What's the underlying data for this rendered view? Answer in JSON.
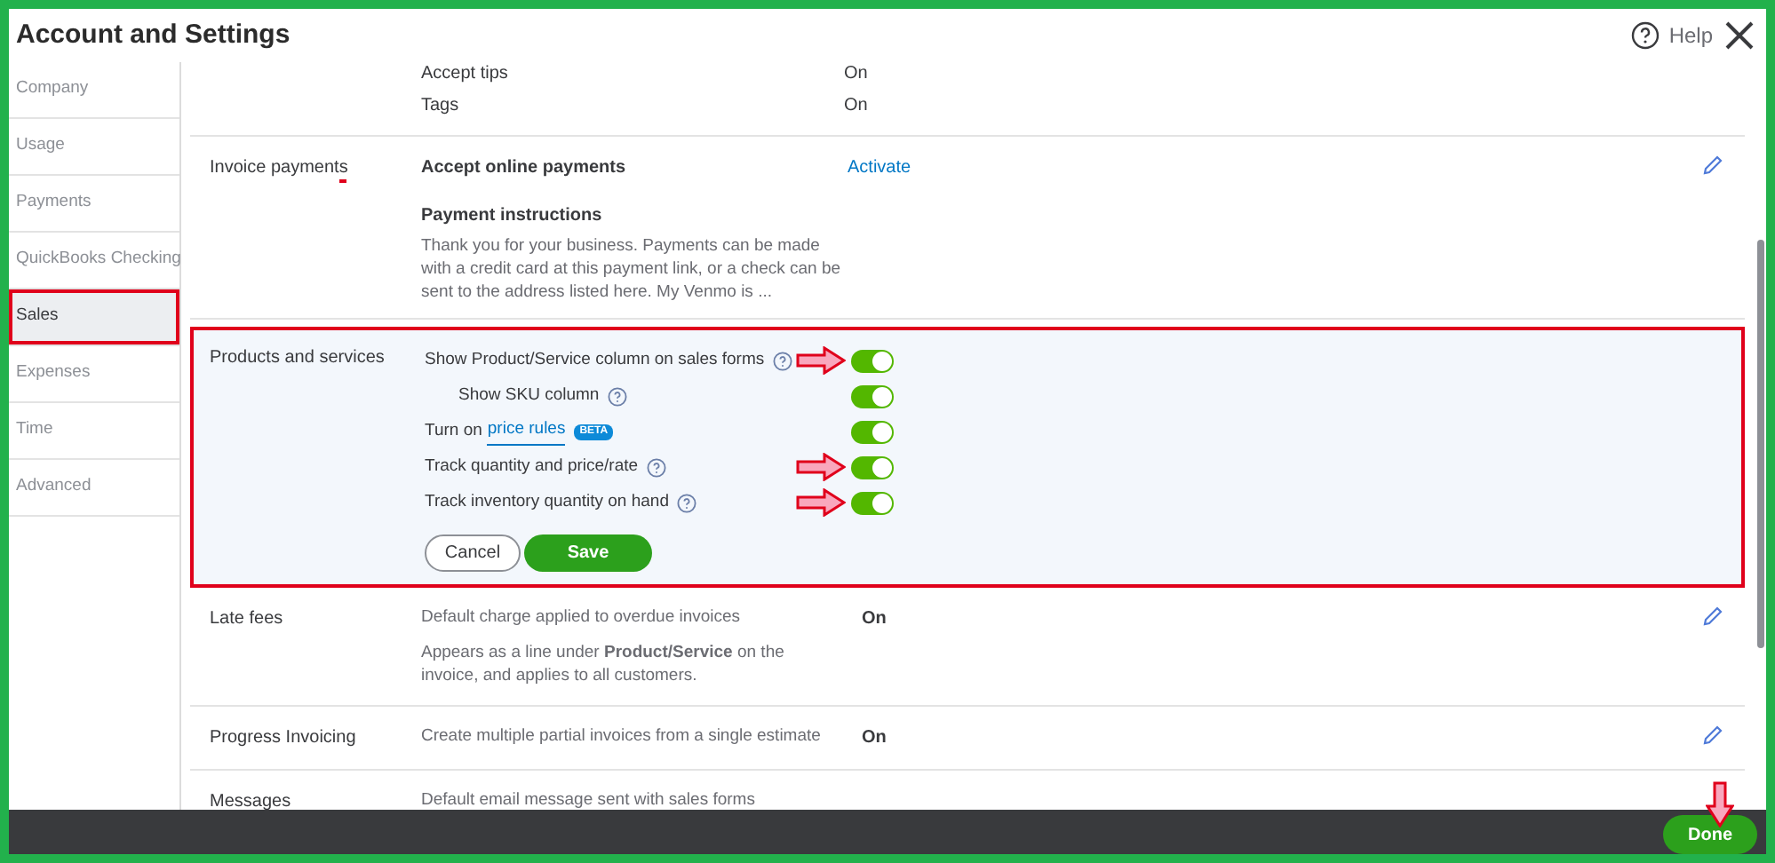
{
  "window": {
    "title": "Account and Settings",
    "help": "Help"
  },
  "sidebar": {
    "items": [
      {
        "label": "Company",
        "selected": false
      },
      {
        "label": "Usage",
        "selected": false
      },
      {
        "label": "Payments",
        "selected": false
      },
      {
        "label": "QuickBooks Checking",
        "selected": false
      },
      {
        "label": "Sales",
        "selected": true
      },
      {
        "label": "Expenses",
        "selected": false
      },
      {
        "label": "Time",
        "selected": false
      },
      {
        "label": "Advanced",
        "selected": false
      }
    ]
  },
  "sections": [
    {
      "kind": "plain",
      "lines": [
        {
          "label": "Accept tips",
          "value": "On"
        },
        {
          "label": "Tags",
          "value": "On"
        }
      ]
    },
    {
      "kind": "payments",
      "title": "Invoice payments",
      "editable": true,
      "setting": "Accept online payments",
      "action": "Activate",
      "subheading": "Payment instructions",
      "description": "Thank you for your business. Payments can be made with a credit card at this payment link, or a check can be sent to the address listed here. My Venmo is ..."
    },
    {
      "kind": "toggles",
      "title": "Products and services",
      "rows": [
        {
          "label": "Show Product/Service column on sales forms",
          "help": true,
          "on": true,
          "arrow": true,
          "children": [
            {
              "label": "Show SKU column",
              "help": true,
              "on": true,
              "arrow": false
            }
          ]
        },
        {
          "label": "Turn on",
          "link": "price rules",
          "badge": "BETA",
          "help": false,
          "on": true,
          "arrow": false
        },
        {
          "label": "Track quantity and price/rate",
          "help": true,
          "on": true,
          "arrow": true
        },
        {
          "label": "Track inventory quantity on hand",
          "help": true,
          "on": true,
          "arrow": true
        }
      ],
      "cancel": "Cancel",
      "save": "Save"
    },
    {
      "kind": "setting",
      "title": "Late fees",
      "editable": true,
      "text": "Default charge applied to overdue invoices",
      "value": "On",
      "note": "Appears as a line under **Product/Service** on the invoice, and applies to all customers."
    },
    {
      "kind": "setting",
      "title": "Progress Invoicing",
      "editable": true,
      "text": "Create multiple partial invoices from a single estimate",
      "value": "On"
    },
    {
      "kind": "setting",
      "title": "Messages",
      "editable": false,
      "text": "Default email message sent with sales forms"
    }
  ],
  "footer": {
    "done": "Done",
    "arrow": true
  }
}
